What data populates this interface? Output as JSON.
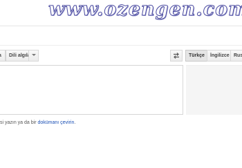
{
  "watermark": {
    "text": "www.ozengen.com"
  },
  "source_language_bar": {
    "partial_button_label": "a",
    "detect_language_label": "Dili algıla"
  },
  "target_language_bar": {
    "buttons": [
      {
        "label": "Türkçe",
        "selected": true
      },
      {
        "label": "İngilizce",
        "selected": false
      },
      {
        "label": "Rus",
        "selected": false
      }
    ]
  },
  "hint": {
    "prefix": "si yazın ya da bir ",
    "link_text": "dokümanı çevirin",
    "suffix": "."
  },
  "colors": {
    "link": "#1a4fb5",
    "selected_tab_bg": "#e5e5e5",
    "target_box_bg": "#f5f5f5"
  },
  "icons": {
    "dropdown": "chevron-down-icon",
    "swap": "swap-languages-icon"
  }
}
